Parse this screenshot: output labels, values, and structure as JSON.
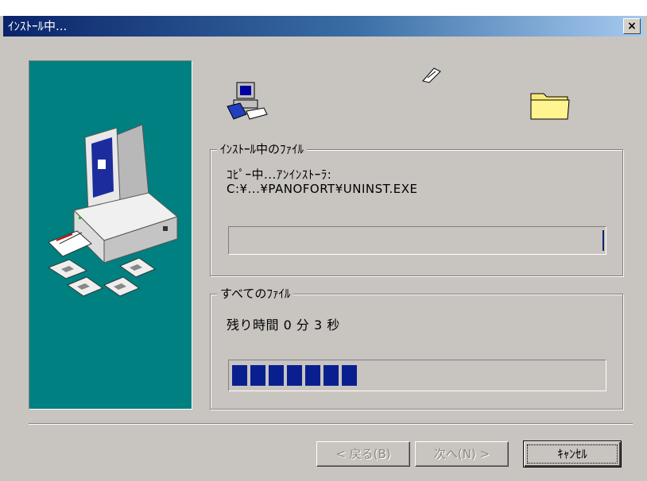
{
  "window": {
    "title": "ｲﾝｽﾄｰﾙ中...",
    "close_glyph": "×"
  },
  "current_file": {
    "group_label": "ｲﾝｽﾄｰﾙ中のﾌｧｲﾙ",
    "line1": "ｺﾋﾟｰ中...ｱﾝｲﾝｽﾄｰﾗ:",
    "line2": "C:¥...¥PANOFORT¥UNINST.EXE",
    "progress_blocks": 0
  },
  "all_files": {
    "group_label": "すべてのﾌｧｲﾙ",
    "time_remaining": "残り時間 0 分 3 秒",
    "progress_blocks": 7
  },
  "buttons": {
    "back": "< 戻る(B)",
    "next": "次へ(N) >",
    "cancel": "ｷｬﾝｾﾙ"
  },
  "icons": {
    "source": "computer-floppy-icon",
    "flying_page": "flying-document-icon",
    "destination": "folder-icon",
    "side_art": "computer-install-illustration"
  }
}
